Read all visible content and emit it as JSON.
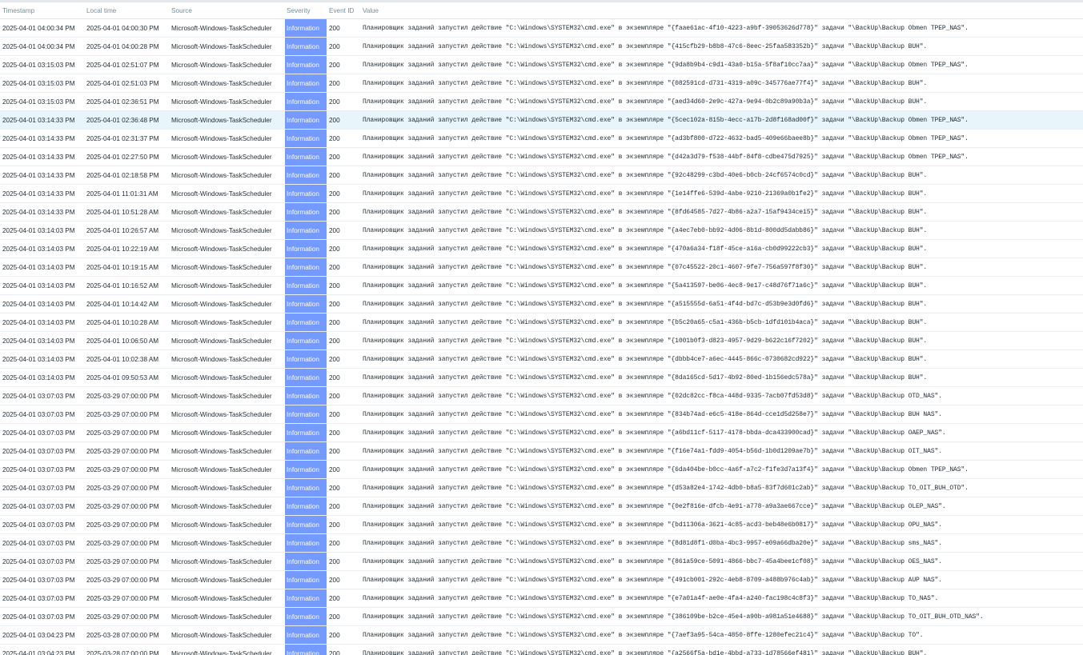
{
  "columns": {
    "timestamp": "Timestamp",
    "local_time": "Local time",
    "source": "Source",
    "severity": "Severity",
    "event_id": "Event ID",
    "value": "Value"
  },
  "colors": {
    "information_severity": "#7499ff",
    "highlighted_row": "#e8f5fa"
  },
  "highlighted_row_index": 5,
  "rows": [
    {
      "timestamp": "2025-04-01 04:00:34 PM",
      "local_time": "2025-04-01 04:00:30 PM",
      "source": "Microsoft-Windows-TaskScheduler",
      "severity": "Information",
      "event_id": "200",
      "value": "Планировщик заданий запустил действие \"C:\\Windows\\SYSTEM32\\cmd.exe\" в экземпляре \"{faae61ac-4f10-4223-a9bf-39053626d778}\" задачи \"\\BackUp\\Backup Obmen TPEP_NAS\"."
    },
    {
      "timestamp": "2025-04-01 04:00:34 PM",
      "local_time": "2025-04-01 04:00:28 PM",
      "source": "Microsoft-Windows-TaskScheduler",
      "severity": "Information",
      "event_id": "200",
      "value": "Планировщик заданий запустил действие \"C:\\Windows\\SYSTEM32\\cmd.exe\" в экземпляре \"{415cfb29-b8b8-47c6-8eec-25faa583352b}\" задачи \"\\BackUp\\Backup BUH\"."
    },
    {
      "timestamp": "2025-04-01 03:15:03 PM",
      "local_time": "2025-04-01 02:51:07 PM",
      "source": "Microsoft-Windows-TaskScheduler",
      "severity": "Information",
      "event_id": "200",
      "value": "Планировщик заданий запустил действие \"C:\\Windows\\SYSTEM32\\cmd.exe\" в экземпляре \"{9da8b9b4-c9d1-43a0-b15a-5f8af10cc7aa}\" задачи \"\\BackUp\\Backup Obmen TPEP_NAS\"."
    },
    {
      "timestamp": "2025-04-01 03:15:03 PM",
      "local_time": "2025-04-01 02:51:03 PM",
      "source": "Microsoft-Windows-TaskScheduler",
      "severity": "Information",
      "event_id": "200",
      "value": "Планировщик заданий запустил действие \"C:\\Windows\\SYSTEM32\\cmd.exe\" в экземпляре \"{082591cd-d731-4319-a09c-345776ae77f4}\" задачи \"\\BackUp\\Backup BUH\"."
    },
    {
      "timestamp": "2025-04-01 03:15:03 PM",
      "local_time": "2025-04-01 02:36:51 PM",
      "source": "Microsoft-Windows-TaskScheduler",
      "severity": "Information",
      "event_id": "200",
      "value": "Планировщик заданий запустил действие \"C:\\Windows\\SYSTEM32\\cmd.exe\" в экземпляре \"{aed34d60-2e9c-427a-9e94-0b2c89a90b3a}\" задачи \"\\BackUp\\Backup BUH\"."
    },
    {
      "timestamp": "2025-04-01 03:14:33 PM",
      "local_time": "2025-04-01 02:36:48 PM",
      "source": "Microsoft-Windows-TaskScheduler",
      "severity": "Information",
      "event_id": "200",
      "value": "Планировщик заданий запустил действие \"C:\\Windows\\SYSTEM32\\cmd.exe\" в экземпляре \"{5cec102a-815b-4ecc-a17b-2d8f168ad00f}\" задачи \"\\BackUp\\Backup Obmen TPEP_NAS\"."
    },
    {
      "timestamp": "2025-04-01 03:14:33 PM",
      "local_time": "2025-04-01 02:31:37 PM",
      "source": "Microsoft-Windows-TaskScheduler",
      "severity": "Information",
      "event_id": "200",
      "value": "Планировщик заданий запустил действие \"C:\\Windows\\SYSTEM32\\cmd.exe\" в экземпляре \"{ad3bf800-d722-4632-bad5-409e66baee8b}\" задачи \"\\BackUp\\Backup Obmen TPEP_NAS\"."
    },
    {
      "timestamp": "2025-04-01 03:14:33 PM",
      "local_time": "2025-04-01 02:27:50 PM",
      "source": "Microsoft-Windows-TaskScheduler",
      "severity": "Information",
      "event_id": "200",
      "value": "Планировщик заданий запустил действие \"C:\\Windows\\SYSTEM32\\cmd.exe\" в экземпляре \"{d42a3d79-f538-44bf-84f8-cdbe475d7925}\" задачи \"\\BackUp\\Backup Obmen TPEP_NAS\"."
    },
    {
      "timestamp": "2025-04-01 03:14:33 PM",
      "local_time": "2025-04-01 02:18:58 PM",
      "source": "Microsoft-Windows-TaskScheduler",
      "severity": "Information",
      "event_id": "200",
      "value": "Планировщик заданий запустил действие \"C:\\Windows\\SYSTEM32\\cmd.exe\" в экземпляре \"{92c48299-c3bd-40e6-b0cb-24cf6574c0cd}\" задачи \"\\BackUp\\Backup BUH\"."
    },
    {
      "timestamp": "2025-04-01 03:14:33 PM",
      "local_time": "2025-04-01 11:01:31 AM",
      "source": "Microsoft-Windows-TaskScheduler",
      "severity": "Information",
      "event_id": "200",
      "value": "Планировщик заданий запустил действие \"C:\\Windows\\SYSTEM32\\cmd.exe\" в экземпляре \"{1e14ffe6-539d-4abe-9210-21369a0b1fe2}\" задачи \"\\BackUp\\Backup BUH\"."
    },
    {
      "timestamp": "2025-04-01 03:14:33 PM",
      "local_time": "2025-04-01 10:51:28 AM",
      "source": "Microsoft-Windows-TaskScheduler",
      "severity": "Information",
      "event_id": "200",
      "value": "Планировщик заданий запустил действие \"C:\\Windows\\SYSTEM32\\cmd.exe\" в экземпляре \"{8fd64585-7d27-4b86-a2a7-15af9434ce15}\" задачи \"\\BackUp\\Backup BUH\"."
    },
    {
      "timestamp": "2025-04-01 03:14:03 PM",
      "local_time": "2025-04-01 10:26:57 AM",
      "source": "Microsoft-Windows-TaskScheduler",
      "severity": "Information",
      "event_id": "200",
      "value": "Планировщик заданий запустил действие \"C:\\Windows\\SYSTEM32\\cmd.exe\" в экземпляре \"{a4ec7eb0-bb92-4d06-8b1d-800dd5dabb86}\" задачи \"\\BackUp\\Backup BUH\"."
    },
    {
      "timestamp": "2025-04-01 03:14:03 PM",
      "local_time": "2025-04-01 10:22:19 AM",
      "source": "Microsoft-Windows-TaskScheduler",
      "severity": "Information",
      "event_id": "200",
      "value": "Планировщик заданий запустил действие \"C:\\Windows\\SYSTEM32\\cmd.exe\" в экземпляре \"{470a6a34-f18f-45ce-a16a-cb0d99222cb3}\" задачи \"\\BackUp\\Backup BUH\"."
    },
    {
      "timestamp": "2025-04-01 03:14:03 PM",
      "local_time": "2025-04-01 10:19:15 AM",
      "source": "Microsoft-Windows-TaskScheduler",
      "severity": "Information",
      "event_id": "200",
      "value": "Планировщик заданий запустил действие \"C:\\Windows\\SYSTEM32\\cmd.exe\" в экземпляре \"{07c45522-20c1-4607-9fe7-756a597f8f30}\" задачи \"\\BackUp\\Backup BUH\"."
    },
    {
      "timestamp": "2025-04-01 03:14:03 PM",
      "local_time": "2025-04-01 10:16:52 AM",
      "source": "Microsoft-Windows-TaskScheduler",
      "severity": "Information",
      "event_id": "200",
      "value": "Планировщик заданий запустил действие \"C:\\Windows\\SYSTEM32\\cmd.exe\" в экземпляре \"{5a413597-be06-4ec8-9e17-c48d76f71a6c}\" задачи \"\\BackUp\\Backup BUH\"."
    },
    {
      "timestamp": "2025-04-01 03:14:03 PM",
      "local_time": "2025-04-01 10:14:42 AM",
      "source": "Microsoft-Windows-TaskScheduler",
      "severity": "Information",
      "event_id": "200",
      "value": "Планировщик заданий запустил действие \"C:\\Windows\\SYSTEM32\\cmd.exe\" в экземпляре \"{a515555d-6a51-4f4d-bd7c-d53b9e3d0fd6}\" задачи \"\\BackUp\\Backup BUH\"."
    },
    {
      "timestamp": "2025-04-01 03:14:03 PM",
      "local_time": "2025-04-01 10:10:28 AM",
      "source": "Microsoft-Windows-TaskScheduler",
      "severity": "Information",
      "event_id": "200",
      "value": "Планировщик заданий запустил действие \"C:\\Windows\\SYSTEM32\\cmd.exe\" в экземпляре \"{b5c20a65-c5a1-436b-b5cb-1dfd101b4aca}\" задачи \"\\BackUp\\Backup BUH\"."
    },
    {
      "timestamp": "2025-04-01 03:14:03 PM",
      "local_time": "2025-04-01 10:06:50 AM",
      "source": "Microsoft-Windows-TaskScheduler",
      "severity": "Information",
      "event_id": "200",
      "value": "Планировщик заданий запустил действие \"C:\\Windows\\SYSTEM32\\cmd.exe\" в экземпляре \"{1001b0f3-d823-4957-9d29-b622c16f7202}\" задачи \"\\BackUp\\Backup BUH\"."
    },
    {
      "timestamp": "2025-04-01 03:14:03 PM",
      "local_time": "2025-04-01 10:02:38 AM",
      "source": "Microsoft-Windows-TaskScheduler",
      "severity": "Information",
      "event_id": "200",
      "value": "Планировщик заданий запустил действие \"C:\\Windows\\SYSTEM32\\cmd.exe\" в экземпляре \"{dbbb4ce7-a6ec-4445-866c-0730682cd922}\" задачи \"\\BackUp\\Backup BUH\"."
    },
    {
      "timestamp": "2025-04-01 03:14:03 PM",
      "local_time": "2025-04-01 09:50:53 AM",
      "source": "Microsoft-Windows-TaskScheduler",
      "severity": "Information",
      "event_id": "200",
      "value": "Планировщик заданий запустил действие \"C:\\Windows\\SYSTEM32\\cmd.exe\" в экземпляре \"{8da165cd-5d17-4b92-80ed-1b156edc578a}\" задачи \"\\BackUp\\Backup BUH\"."
    },
    {
      "timestamp": "2025-04-01 03:07:03 PM",
      "local_time": "2025-03-29 07:00:00 PM",
      "source": "Microsoft-Windows-TaskScheduler",
      "severity": "Information",
      "event_id": "200",
      "value": "Планировщик заданий запустил действие \"C:\\Windows\\SYSTEM32\\cmd.exe\" в экземпляре \"{02dc82cc-f8ca-448d-9335-7acb07fd53d8}\" задачи \"\\BackUp\\Backup OTD_NAS\"."
    },
    {
      "timestamp": "2025-04-01 03:07:03 PM",
      "local_time": "2025-03-29 07:00:00 PM",
      "source": "Microsoft-Windows-TaskScheduler",
      "severity": "Information",
      "event_id": "200",
      "value": "Планировщик заданий запустил действие \"C:\\Windows\\SYSTEM32\\cmd.exe\" в экземпляре \"{834b74ad-e6c5-418e-864d-cce1d5d258e7}\" задачи \"\\BackUp\\Backup BUH NAS\"."
    },
    {
      "timestamp": "2025-04-01 03:07:03 PM",
      "local_time": "2025-03-29 07:00:00 PM",
      "source": "Microsoft-Windows-TaskScheduler",
      "severity": "Information",
      "event_id": "200",
      "value": "Планировщик заданий запустил действие \"C:\\Windows\\SYSTEM32\\cmd.exe\" в экземпляре \"{a6bd11cf-5117-4178-bbda-dca433900cad}\" задачи \"\\BackUp\\Backup OAEP_NAS\"."
    },
    {
      "timestamp": "2025-04-01 03:07:03 PM",
      "local_time": "2025-03-29 07:00:00 PM",
      "source": "Microsoft-Windows-TaskScheduler",
      "severity": "Information",
      "event_id": "200",
      "value": "Планировщик заданий запустил действие \"C:\\Windows\\SYSTEM32\\cmd.exe\" в экземпляре \"{f16e74a1-fdd9-4054-b56d-1b0d1209ae7b}\" задачи \"\\BackUp\\Backup OIT_NAS\"."
    },
    {
      "timestamp": "2025-04-01 03:07:03 PM",
      "local_time": "2025-03-29 07:00:00 PM",
      "source": "Microsoft-Windows-TaskScheduler",
      "severity": "Information",
      "event_id": "200",
      "value": "Планировщик заданий запустил действие \"C:\\Windows\\SYSTEM32\\cmd.exe\" в экземпляре \"{6da404be-b0cc-4a6f-a7c2-f1fe3d7a13f4}\" задачи \"\\BackUp\\Backup Obmen TPEP_NAS\"."
    },
    {
      "timestamp": "2025-04-01 03:07:03 PM",
      "local_time": "2025-03-29 07:00:00 PM",
      "source": "Microsoft-Windows-TaskScheduler",
      "severity": "Information",
      "event_id": "200",
      "value": "Планировщик заданий запустил действие \"C:\\Windows\\SYSTEM32\\cmd.exe\" в экземпляре \"{d53a82e4-1742-4db0-b8a5-83f7d601c2ab}\" задачи \"\\BackUp\\Backup TO_OIT_BUH_OTD\"."
    },
    {
      "timestamp": "2025-04-01 03:07:03 PM",
      "local_time": "2025-03-29 07:00:00 PM",
      "source": "Microsoft-Windows-TaskScheduler",
      "severity": "Information",
      "event_id": "200",
      "value": "Планировщик заданий запустил действие \"C:\\Windows\\SYSTEM32\\cmd.exe\" в экземпляре \"{0e2f816e-dfcb-4e91-a778-a9a3ae667cce}\" задачи \"\\BackUp\\Backup OLEP_NAS\"."
    },
    {
      "timestamp": "2025-04-01 03:07:03 PM",
      "local_time": "2025-03-29 07:00:00 PM",
      "source": "Microsoft-Windows-TaskScheduler",
      "severity": "Information",
      "event_id": "200",
      "value": "Планировщик заданий запустил действие \"C:\\Windows\\SYSTEM32\\cmd.exe\" в экземпляре \"{bd11306a-3621-4c85-acd3-beb48e6b0817}\" задачи \"\\BackUp\\Backup OPU_NAS\"."
    },
    {
      "timestamp": "2025-04-01 03:07:03 PM",
      "local_time": "2025-03-29 07:00:00 PM",
      "source": "Microsoft-Windows-TaskScheduler",
      "severity": "Information",
      "event_id": "200",
      "value": "Планировщик заданий запустил действие \"C:\\Windows\\SYSTEM32\\cmd.exe\" в экземпляре \"{8d81d8f1-d0ba-4bc3-9957-e09a66dba20e}\" задачи \"\\BackUp\\Backup sms_NAS\"."
    },
    {
      "timestamp": "2025-04-01 03:07:03 PM",
      "local_time": "2025-03-29 07:00:00 PM",
      "source": "Microsoft-Windows-TaskScheduler",
      "severity": "Information",
      "event_id": "200",
      "value": "Планировщик заданий запустил действие \"C:\\Windows\\SYSTEM32\\cmd.exe\" в экземпляре \"{861a59ce-5091-4866-bbc7-45a4bee1cf08}\" задачи \"\\BackUp\\Backup OES_NAS\"."
    },
    {
      "timestamp": "2025-04-01 03:07:03 PM",
      "local_time": "2025-03-29 07:00:00 PM",
      "source": "Microsoft-Windows-TaskScheduler",
      "severity": "Information",
      "event_id": "200",
      "value": "Планировщик заданий запустил действие \"C:\\Windows\\SYSTEM32\\cmd.exe\" в экземпляре \"{491cb001-292c-4eb8-8709-a488b976c4ab}\" задачи \"\\BackUp\\Backup AUP NAS\"."
    },
    {
      "timestamp": "2025-04-01 03:07:03 PM",
      "local_time": "2025-03-29 07:00:00 PM",
      "source": "Microsoft-Windows-TaskScheduler",
      "severity": "Information",
      "event_id": "200",
      "value": "Планировщик заданий запустил действие \"C:\\Windows\\SYSTEM32\\cmd.exe\" в экземпляре \"{e7a01a4f-ae0e-4fa4-a240-fac198c4c8f3}\" задачи \"\\BackUp\\Backup TO_NAS\"."
    },
    {
      "timestamp": "2025-04-01 03:07:03 PM",
      "local_time": "2025-03-29 07:00:00 PM",
      "source": "Microsoft-Windows-TaskScheduler",
      "severity": "Information",
      "event_id": "200",
      "value": "Планировщик заданий запустил действие \"C:\\Windows\\SYSTEM32\\cmd.exe\" в экземпляре \"{386109be-b2ce-45e4-a90b-a981a51e4688}\" задачи \"\\BackUp\\Backup TO_OIT_BUH_OTD_NAS\"."
    },
    {
      "timestamp": "2025-04-01 03:04:23 PM",
      "local_time": "2025-03-28 07:00:00 PM",
      "source": "Microsoft-Windows-TaskScheduler",
      "severity": "Information",
      "event_id": "200",
      "value": "Планировщик заданий запустил действие \"C:\\Windows\\SYSTEM32\\cmd.exe\" в экземпляре \"{7aef3a95-54ca-4850-8ffe-1280efec21c4}\" задачи \"\\BackUp\\Backup TO\"."
    },
    {
      "timestamp": "2025-04-01 03:04:23 PM",
      "local_time": "2025-03-28 07:00:00 PM",
      "source": "Microsoft-Windows-TaskScheduler",
      "severity": "Information",
      "event_id": "200",
      "value": "Планировщик заданий запустил действие \"C:\\Windows\\SYSTEM32\\cmd.exe\" в экземпляре \"{a2566f5a-bd1e-4bbd-a733-1d78566ef481}\" задачи \"\\BackUp\\Backup BUH\"."
    }
  ]
}
